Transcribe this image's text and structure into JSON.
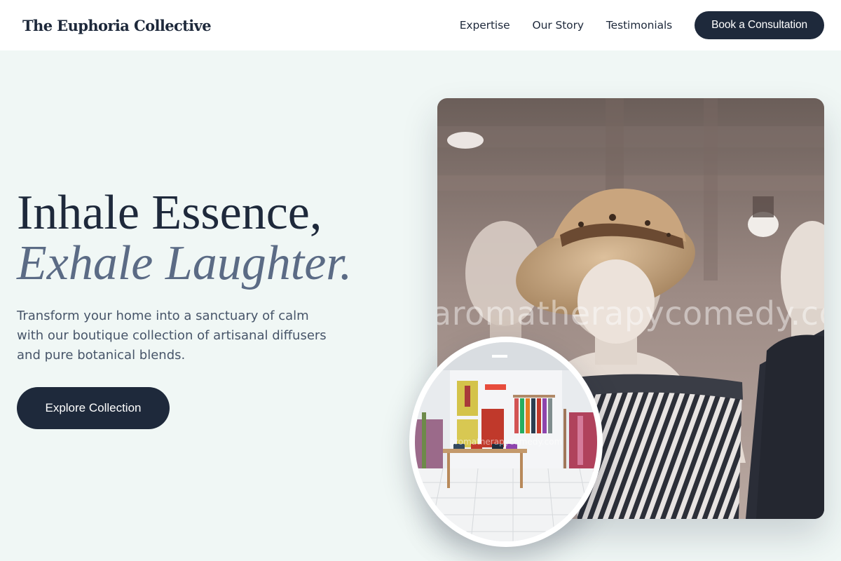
{
  "header": {
    "brand": "The Euphoria Collective",
    "nav": [
      {
        "label": "Expertise"
      },
      {
        "label": "Our Story"
      },
      {
        "label": "Testimonials"
      }
    ],
    "cta_label": "Book a Consultation"
  },
  "hero": {
    "title_line1": "Inhale Essence,",
    "title_line2": "Exhale Laughter.",
    "subtitle": "Transform your home into a sanctuary of calm with our boutique collection of artisanal diffusers and pure botanical blends.",
    "button_label": "Explore Collection"
  },
  "main_image": {
    "alt": "Mannequins in a boutique wearing a straw sun hat and striped top",
    "watermark": "aromatherapycomedy.com"
  },
  "inset_image": {
    "alt": "Bright boutique interior with clothing racks and a display table",
    "watermark": "aromatherapycomedy.com"
  },
  "colors": {
    "page_bg": "#f0f7f5",
    "primary": "#1e293b",
    "accent_text": "#5b6b85",
    "body_text": "#475569"
  }
}
